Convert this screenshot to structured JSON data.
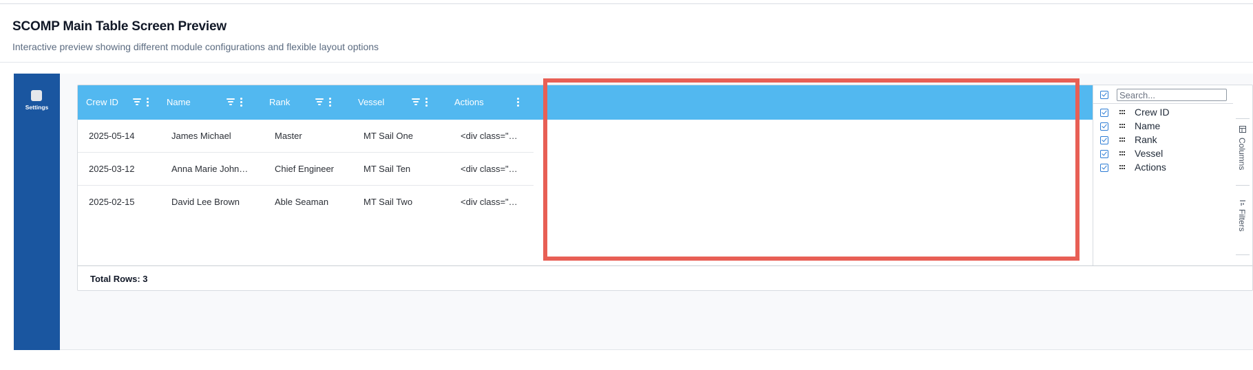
{
  "header": {
    "title": "SCOMP Main Table Screen Preview",
    "subtitle": "Interactive preview showing different module configurations and flexible layout options"
  },
  "left_rail": {
    "settings_label": "Settings",
    "settings_icon": "settings-icon"
  },
  "grid": {
    "columns": [
      {
        "label": "Crew ID",
        "filterable": true,
        "has_menu": true
      },
      {
        "label": "Name",
        "filterable": true,
        "has_menu": true
      },
      {
        "label": "Rank",
        "filterable": true,
        "has_menu": true
      },
      {
        "label": "Vessel",
        "filterable": true,
        "has_menu": true
      },
      {
        "label": "Actions",
        "filterable": false,
        "has_menu": true
      }
    ],
    "rows": [
      [
        "2025-05-14",
        "James Michael",
        "Master",
        "MT Sail One",
        "<div class=\"…"
      ],
      [
        "2025-03-12",
        "Anna Marie John…",
        "Chief Engineer",
        "MT Sail Ten",
        "<div class=\"…"
      ],
      [
        "2025-02-15",
        "David Lee Brown",
        "Able Seaman",
        "MT Sail Two",
        "<div class=\"…"
      ]
    ],
    "status": "Total Rows: 3"
  },
  "columns_panel": {
    "search_placeholder": "Search...",
    "select_all_checked": true,
    "items": [
      {
        "label": "Crew ID",
        "checked": true
      },
      {
        "label": "Name",
        "checked": true
      },
      {
        "label": "Rank",
        "checked": true
      },
      {
        "label": "Vessel",
        "checked": true
      },
      {
        "label": "Actions",
        "checked": true
      }
    ]
  },
  "side_tabs": [
    {
      "label": "Columns",
      "icon": "columns-icon"
    },
    {
      "label": "Filters",
      "icon": "filter-icon"
    }
  ],
  "colors": {
    "rail": "#1a56a0",
    "grid_header": "#52b8f0",
    "highlight": "#e85f55",
    "checkbox": "#2b7bd4"
  }
}
